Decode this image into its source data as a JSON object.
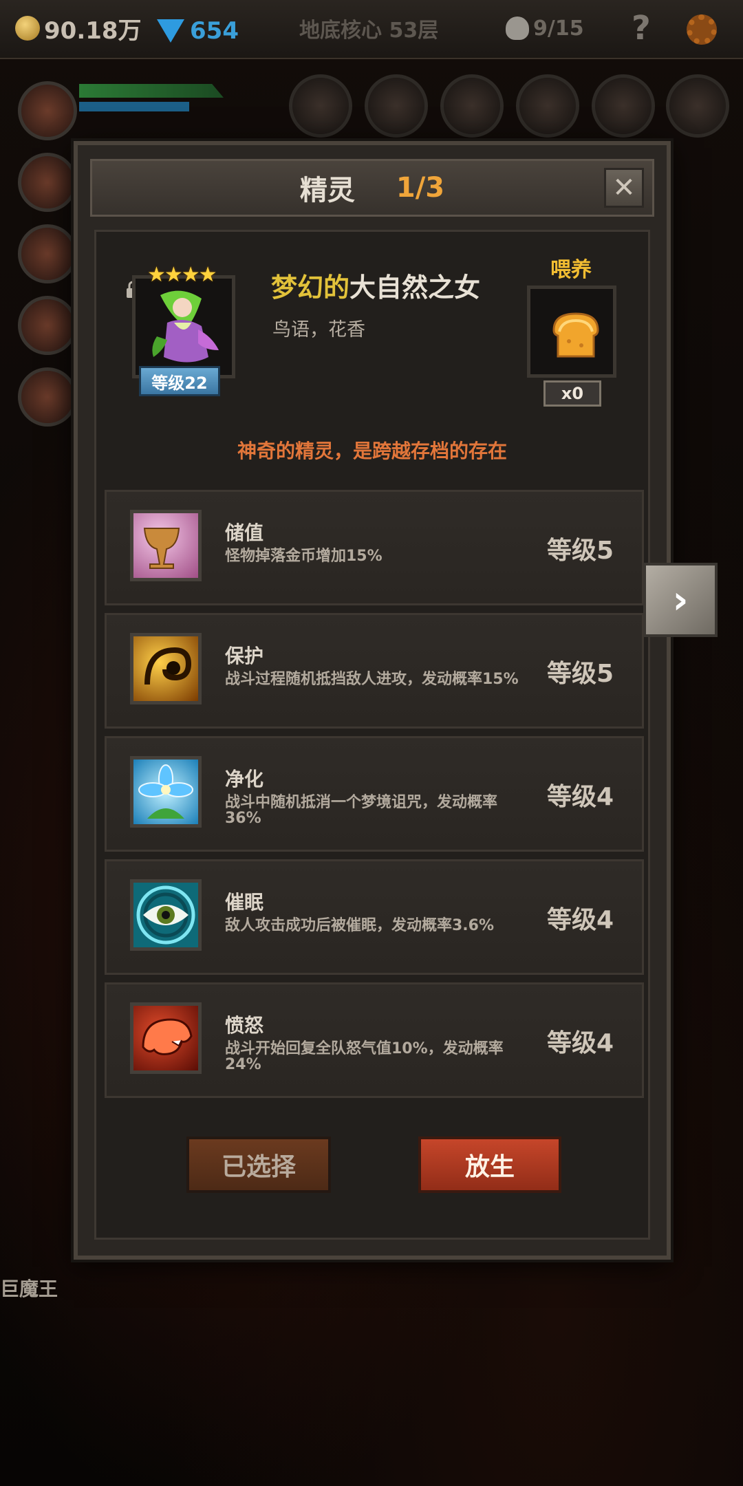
{
  "topbar": {
    "gold": "90.18万",
    "gems": "654",
    "location": "地底核心 53层",
    "kills": "9/15",
    "help": "?"
  },
  "scene": {
    "boss_label": "巨魔王"
  },
  "dialog": {
    "title": "精灵",
    "page": "1/3",
    "close": "✕",
    "spirit": {
      "stars": "★★★★",
      "level": "等级22",
      "name_prefix": "梦幻的",
      "name_main": "大自然之女",
      "subtitle": "鸟语，花香",
      "feed_label": "喂养",
      "feed_count": "x0",
      "tagline": "神奇的精灵，是跨越存档的存在"
    },
    "skills": [
      {
        "name": "储值",
        "desc": "怪物掉落金币增加15%",
        "level": "等级5",
        "icon": "grail-icon",
        "color": "#c07ab0"
      },
      {
        "name": "保护",
        "desc": "战斗过程随机抵挡敌人进攻，发动概率15%",
        "level": "等级5",
        "icon": "swirl-shield-icon",
        "color": "#e09a20"
      },
      {
        "name": "净化",
        "desc": "战斗中随机抵消一个梦境诅咒，发动概率36%",
        "level": "等级4",
        "icon": "blue-flower-icon",
        "color": "#3fa8de"
      },
      {
        "name": "催眠",
        "desc": "敌人攻击成功后被催眠，发动概率3.6%",
        "level": "等级4",
        "icon": "hypno-eye-icon",
        "color": "#2bb6c9"
      },
      {
        "name": "愤怒",
        "desc": "战斗开始回复全队怒气值10%，发动概率24%",
        "level": "等级4",
        "icon": "roaring-beast-icon",
        "color": "#c2331f"
      }
    ],
    "buttons": {
      "selected": "已选择",
      "release": "放生"
    },
    "next": "›"
  }
}
